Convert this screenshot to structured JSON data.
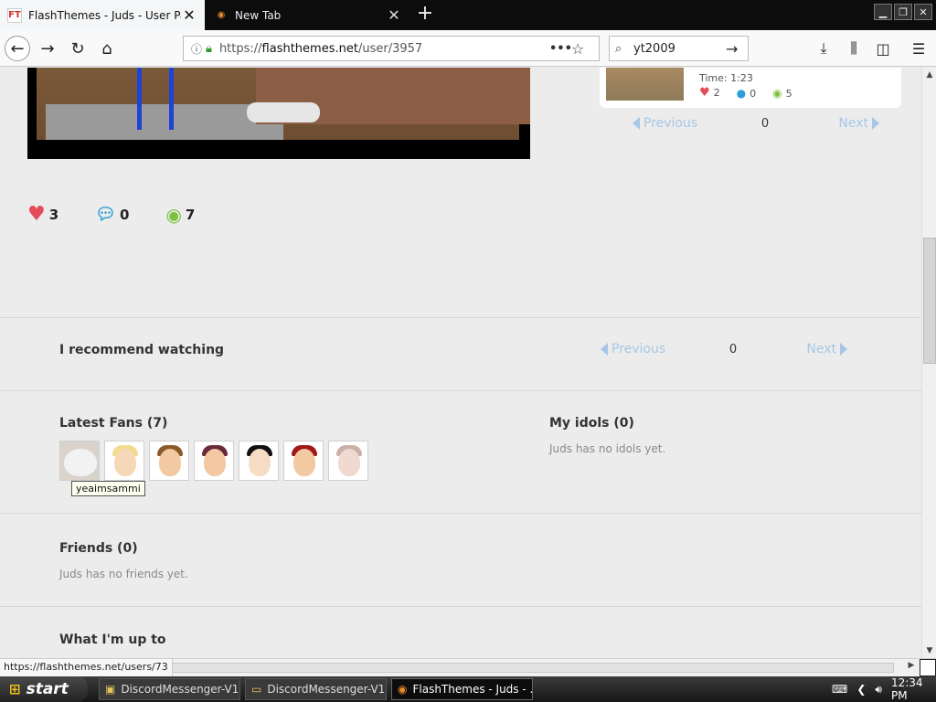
{
  "browser": {
    "tabs": [
      {
        "title": "FlashThemes - Juds - User Page",
        "favicon": "FT",
        "active": true
      },
      {
        "title": "New Tab",
        "favicon": "firefox-icon",
        "active": false
      }
    ],
    "url_prefix": "https://",
    "url_host": "flashthemes.net",
    "url_path": "/user/3957",
    "search_value": "yt2009"
  },
  "mini_card": {
    "time": "Time: 1:23",
    "likes": "2",
    "comments": "0",
    "views": "5"
  },
  "mini_pager": {
    "prev": "Previous",
    "page": "0",
    "next": "Next"
  },
  "video_stats": {
    "likes": "3",
    "comments": "0",
    "views": "7"
  },
  "recommend": {
    "title": "I recommend watching",
    "pager": {
      "prev": "Previous",
      "page": "0",
      "next": "Next"
    }
  },
  "fans": {
    "title": "Latest Fans (7)",
    "tooltip": "yeaimsammi"
  },
  "idols": {
    "title": "My idols (0)",
    "empty": "Juds has no idols yet."
  },
  "friends": {
    "title": "Friends (0)",
    "empty": "Juds has no friends yet."
  },
  "upto": {
    "title": "What I'm up to"
  },
  "status_link": "https://flashthemes.net/users/73",
  "taskbar": {
    "start": "start",
    "tasks": [
      "DiscordMessenger-V1...",
      "DiscordMessenger-V1...",
      "FlashThemes - Juds - ..."
    ],
    "clock": "12:34 PM"
  },
  "colors": {
    "heart": "#e44c5a",
    "comment": "#2a9fd6",
    "eye": "#7cc23e",
    "pager_link": "#a6c8e6"
  }
}
